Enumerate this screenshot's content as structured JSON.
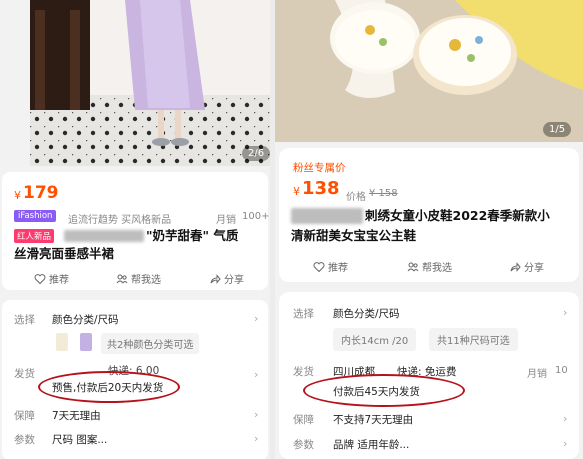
{
  "left": {
    "photo_counter": "2/6",
    "price_symbol": "¥",
    "price": "179",
    "brand_badge": "iFashion",
    "brand_tags": "追流行趋势 买风格新品",
    "sales_label": "月销",
    "sales_value": "100+",
    "new_badge": "红人新品",
    "title_line1": "\"奶芋甜春\" 气质",
    "title_line2": "丝滑亮面垂感半裙",
    "actions": {
      "recommend": "推荐",
      "help_choose": "帮我选",
      "share": "分享"
    },
    "select_label": "选择",
    "select_value": "颜色分类/尺码",
    "select_chip": "共2种颜色分类可选",
    "ship_label": "发货",
    "ship_info": "快递: 6.00",
    "ship_note": "预售,付款后20天内发货",
    "guarantee_label": "保障",
    "guarantee_value": "7天无理由",
    "params_label": "参数",
    "params_value": "尺码  图案..."
  },
  "right": {
    "photo_counter": "1/5",
    "fan_price_label": "粉丝专属价",
    "price_symbol": "¥",
    "price": "138",
    "orig_price_label": "价格",
    "orig_price": "¥ 158",
    "title_line1": "刺绣女童小皮鞋2022春季新款小",
    "title_line2": "清新甜美女宝宝公主鞋",
    "actions": {
      "recommend": "推荐",
      "help_choose": "帮我选",
      "share": "分享"
    },
    "select_label": "选择",
    "select_value": "颜色分类/尺码",
    "select_chip1": "内长14cm /20",
    "select_chip2": "共11种尺码可选",
    "ship_label": "发货",
    "ship_location": "四川成都",
    "ship_express": "快递: 免运费",
    "sales_label": "月销",
    "sales_value": "10",
    "ship_note": "付款后45天内发货",
    "guarantee_label": "保障",
    "guarantee_value": "不支持7天无理由",
    "params_label": "参数",
    "params_value": "品牌  适用年龄..."
  },
  "colors": {
    "accent": "#ff5000",
    "highlight_ring": "#b5121b",
    "brand_badge_bg": "#8a5cf6",
    "new_badge_bg": "#ff3a6e"
  }
}
